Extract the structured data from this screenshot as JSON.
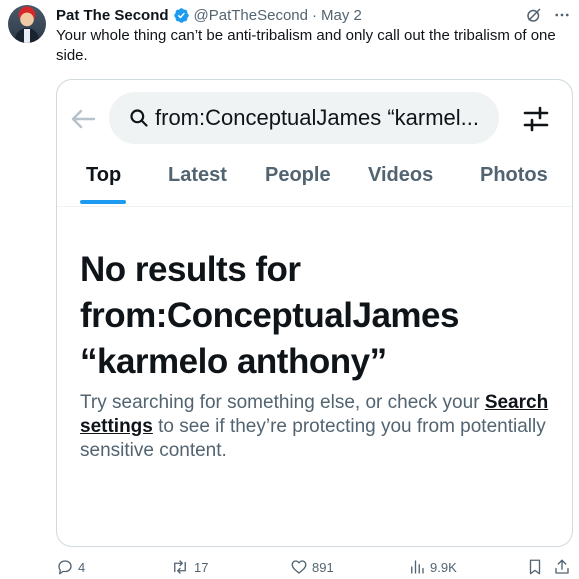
{
  "author": {
    "name": "Pat The Second",
    "handle": "@PatTheSecond",
    "separator": "·",
    "date": "May 2"
  },
  "tweet_text": "Your whole thing can’t be anti-tribalism and only call out the tribalism of one side.",
  "embedded": {
    "search_query": "from:ConceptualJames “karmel...",
    "tabs": [
      "Top",
      "Latest",
      "People",
      "Videos",
      "Photos"
    ],
    "active_tab": "Top",
    "no_results_line1": "No results for",
    "no_results_line2": "from:ConceptualJames",
    "no_results_line3": "“karmelo anthony”",
    "hint_prefix": "Try searching for something else, or check your",
    "hint_link": "Search settings",
    "hint_suffix": "to see if they’re protecting you from potentially sensitive content."
  },
  "metrics": {
    "replies": "4",
    "reposts": "17",
    "likes": "891",
    "views": "9.9K"
  },
  "icons": {
    "verified": "verified-badge-icon",
    "grok": "grok-icon",
    "more": "more-icon",
    "back": "back-arrow-icon",
    "search": "search-icon",
    "filter": "filter-icon",
    "reply": "reply-icon",
    "repost": "repost-icon",
    "like": "heart-icon",
    "views": "views-icon",
    "bookmark": "bookmark-icon",
    "share": "share-icon"
  },
  "colors": {
    "accent": "#1d9bf0",
    "text_primary": "#0f1419",
    "text_secondary": "#536471"
  }
}
